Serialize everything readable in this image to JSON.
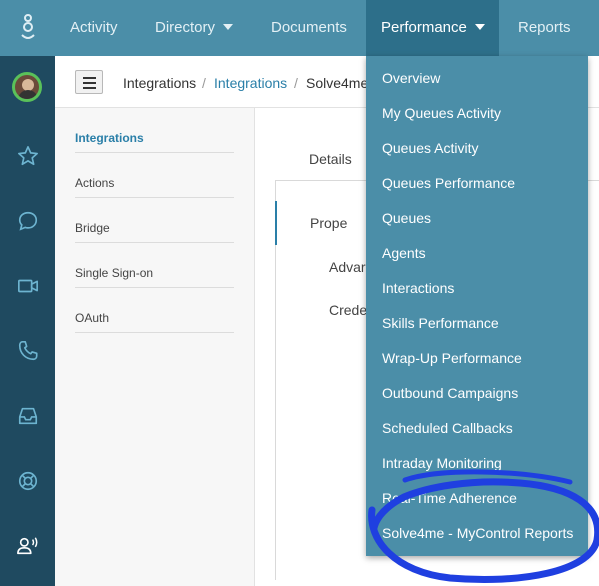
{
  "topnav": {
    "items": [
      {
        "label": "Activity"
      },
      {
        "label": "Directory"
      },
      {
        "label": "Documents"
      },
      {
        "label": "Performance"
      },
      {
        "label": "Reports"
      }
    ]
  },
  "breadcrumb": {
    "items": [
      "Integrations",
      "Integrations",
      "Solve4me"
    ],
    "separator": "/"
  },
  "submenu": {
    "items": [
      "Integrations",
      "Actions",
      "Bridge",
      "Single Sign-on",
      "OAuth"
    ]
  },
  "content": {
    "tab": "Details",
    "vtabs": [
      "Prope",
      "Advar",
      "Crede"
    ]
  },
  "performance_menu": {
    "items": [
      "Overview",
      "My Queues Activity",
      "Queues Activity",
      "Queues Performance",
      "Queues",
      "Agents",
      "Interactions",
      "Skills Performance",
      "Wrap-Up Performance",
      "Outbound Campaigns",
      "Scheduled Callbacks",
      "Intraday Monitoring",
      "Real-Time Adherence",
      "Solve4me - MyControl Reports"
    ]
  },
  "rail": {
    "icons": [
      "genesys-logo-icon",
      "avatar",
      "star-icon",
      "chat-bubble-icon",
      "video-icon",
      "phone-icon",
      "inbox-icon",
      "support-ring-icon",
      "user-voice-icon"
    ]
  },
  "colors": {
    "nav": "#4b8ea8",
    "nav_active": "#2d6f8a",
    "rail": "#1f4a60",
    "link": "#2a7fa8",
    "annotation": "#1f3fe0"
  }
}
